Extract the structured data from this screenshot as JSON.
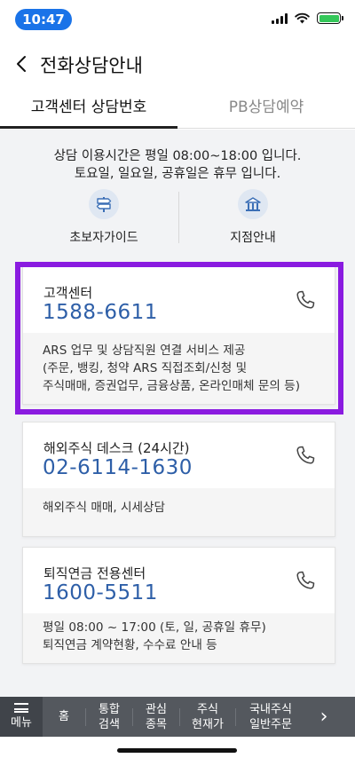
{
  "status": {
    "time": "10:47"
  },
  "header": {
    "title": "전화상담안내"
  },
  "tabs": [
    {
      "label": "고객센터 상담번호"
    },
    {
      "label": "PB상담예약"
    }
  ],
  "info": {
    "line1": "상담 이용시간은 평일 08:00~18:00 입니다.",
    "line2": "토요일, 일요일, 공휴일은 휴무 입니다."
  },
  "guides": [
    {
      "label": "초보자가이드",
      "icon": "signpost-icon"
    },
    {
      "label": "지점안내",
      "icon": "branch-pin-icon"
    }
  ],
  "cards": [
    {
      "name": "고객센터",
      "phone": "1588-6611",
      "desc": [
        "ARS 업무 및 상담직원 연결 서비스 제공",
        "(주문, 뱅킹, 청약 ARS 직접조회/신청 및",
        "주식매매, 증권업무, 금융상품, 온라인매체 문의 등)"
      ]
    },
    {
      "name": "해외주식 데스크 (24시간)",
      "phone": "02-6114-1630",
      "desc": [
        "해외주식 매매, 시세상담"
      ]
    },
    {
      "name": "퇴직연금 전용센터",
      "phone": "1600-5511",
      "desc": [
        "평일 08:00 ~ 17:00 (토, 일, 공휴일 휴무)",
        "퇴직연금 계약현황, 수수료 안내 등"
      ]
    }
  ],
  "bottom_nav": {
    "menu": "메뉴",
    "items": [
      {
        "line1": "홈",
        "line2": ""
      },
      {
        "line1": "통합",
        "line2": "검색"
      },
      {
        "line1": "관심",
        "line2": "종목"
      },
      {
        "line1": "주식",
        "line2": "현재가"
      },
      {
        "line1": "국내주식",
        "line2": "일반주문"
      }
    ],
    "more": "›"
  },
  "colors": {
    "accent": "#2e5fa8",
    "highlight": "#8a1be0",
    "time_pill": "#1a73e8",
    "nav_bg": "#54585e"
  }
}
